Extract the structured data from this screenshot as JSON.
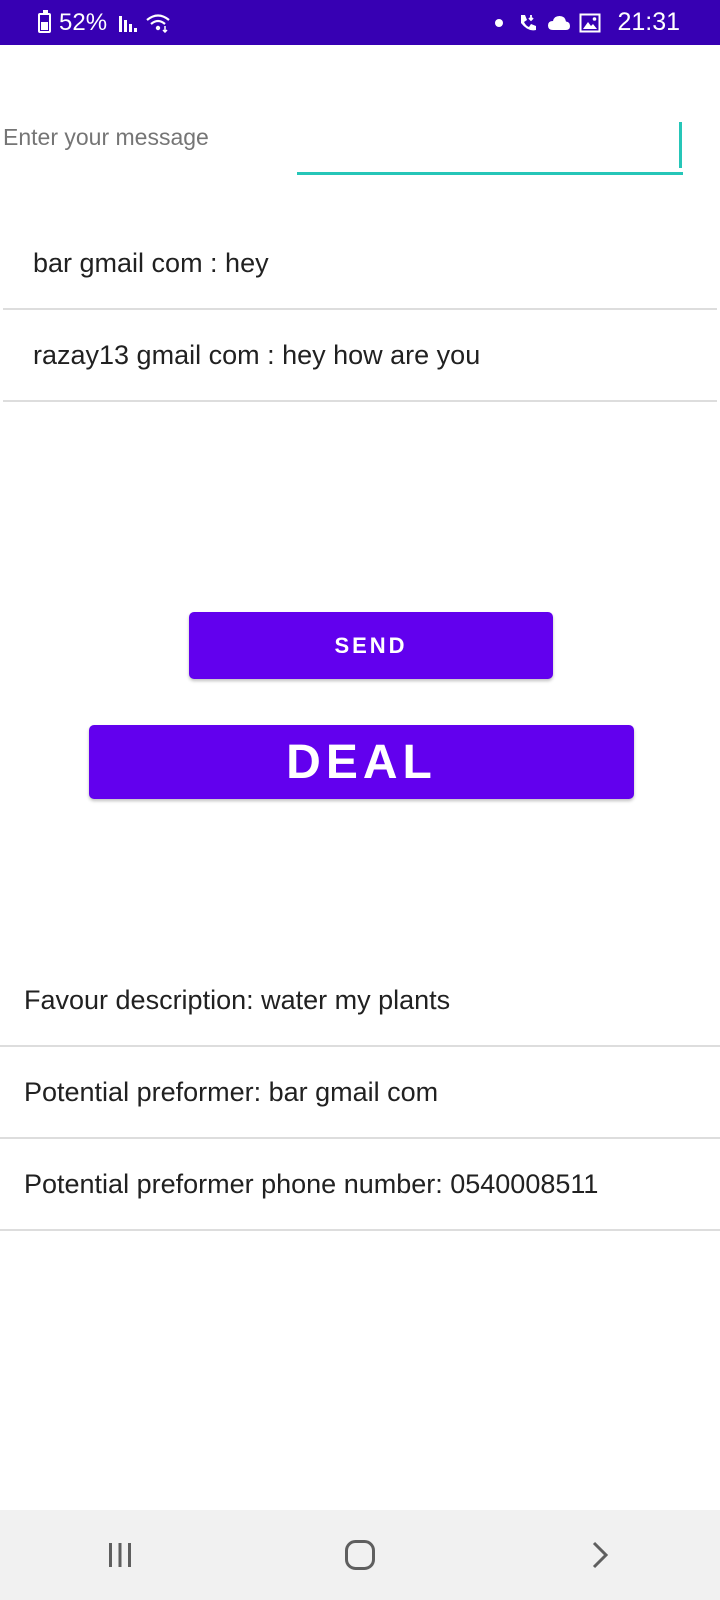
{
  "colors": {
    "status_bar": "#3700b3",
    "accent": "#6200ee",
    "input_underline": "#26c6b8",
    "nav_bar": "#f1f1f1"
  },
  "status_bar": {
    "battery": "52%",
    "time": "21:31",
    "icons": [
      "battery-icon",
      "signal-icon",
      "wifi-icon",
      "dot-icon",
      "call-icon",
      "cloud-icon",
      "image-icon"
    ]
  },
  "message_input": {
    "placeholder": "Enter your message",
    "value": ""
  },
  "chat": {
    "messages": [
      "bar gmail com : hey",
      "razay13 gmail com : hey how are you"
    ]
  },
  "buttons": {
    "send": "SEND",
    "deal": "DEAL"
  },
  "details": {
    "items": [
      "Favour description: water my plants",
      "Potential preformer: bar gmail com",
      "Potential preformer phone number: 0540008511"
    ]
  },
  "nav_bar": {
    "icons": [
      "recents-icon",
      "home-icon",
      "back-icon"
    ]
  }
}
